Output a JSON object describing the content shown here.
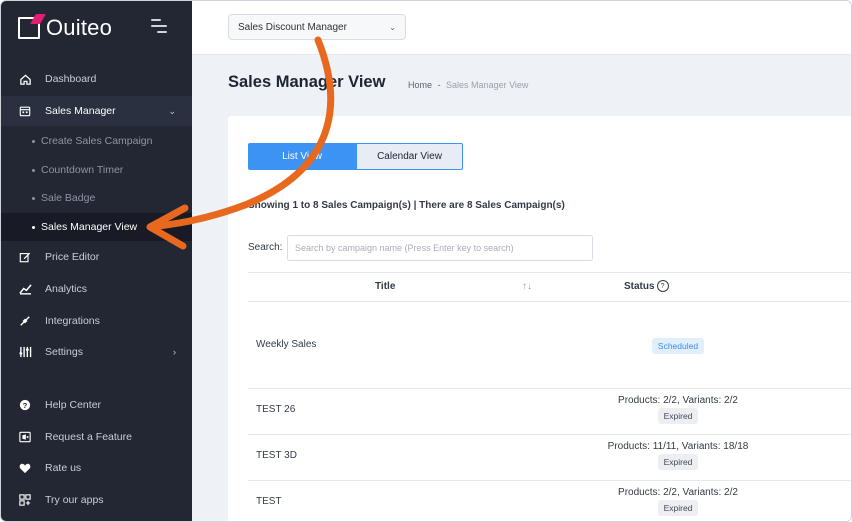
{
  "brand": {
    "name": "Ouiteo"
  },
  "sidebar": {
    "items": [
      {
        "label": "Dashboard",
        "icon": "home-icon"
      },
      {
        "label": "Sales Manager",
        "icon": "calendar-icon"
      },
      {
        "label": "Price Editor",
        "icon": "edit-icon"
      },
      {
        "label": "Analytics",
        "icon": "chart-icon"
      },
      {
        "label": "Integrations",
        "icon": "plug-icon"
      },
      {
        "label": "Settings",
        "icon": "sliders-icon"
      },
      {
        "label": "Help Center",
        "icon": "help-icon"
      },
      {
        "label": "Request a Feature",
        "icon": "feature-icon"
      },
      {
        "label": "Rate us",
        "icon": "heart-icon"
      },
      {
        "label": "Try our apps",
        "icon": "apps-icon"
      }
    ],
    "sub_items": [
      {
        "label": "Create Sales Campaign"
      },
      {
        "label": "Countdown Timer"
      },
      {
        "label": "Sale Badge"
      },
      {
        "label": "Sales Manager View"
      }
    ]
  },
  "topbar": {
    "app_select": "Sales Discount Manager"
  },
  "page": {
    "title": "Sales Manager View",
    "breadcrumb_home": "Home",
    "breadcrumb_sep": "-",
    "breadcrumb_current": "Sales Manager View"
  },
  "tabs": {
    "list": "List View",
    "calendar": "Calendar View"
  },
  "summary": "Showing 1 to 8 Sales Campaign(s) | There are 8 Sales Campaign(s)",
  "search": {
    "label": "Search:",
    "placeholder": "Search by campaign name (Press Enter key to search)"
  },
  "table": {
    "headers": {
      "title": "Title",
      "sort": "↑↓",
      "status": "Status",
      "help": "?"
    },
    "rows": [
      {
        "title": "Weekly Sales",
        "status": "",
        "badge": "Scheduled"
      },
      {
        "title": "TEST 26",
        "status": "Products: 2/2, Variants: 2/2",
        "badge": "Expired"
      },
      {
        "title": "TEST 3D",
        "status": "Products: 11/11, Variants: 18/18",
        "badge": "Expired"
      },
      {
        "title": "TEST",
        "status": "Products: 2/2, Variants: 2/2",
        "badge": "Expired"
      }
    ]
  },
  "colors": {
    "sidebar": "#232733",
    "accent": "#3d93f4",
    "arrow": "#e8691e",
    "brand_mark": "#e11d74"
  }
}
